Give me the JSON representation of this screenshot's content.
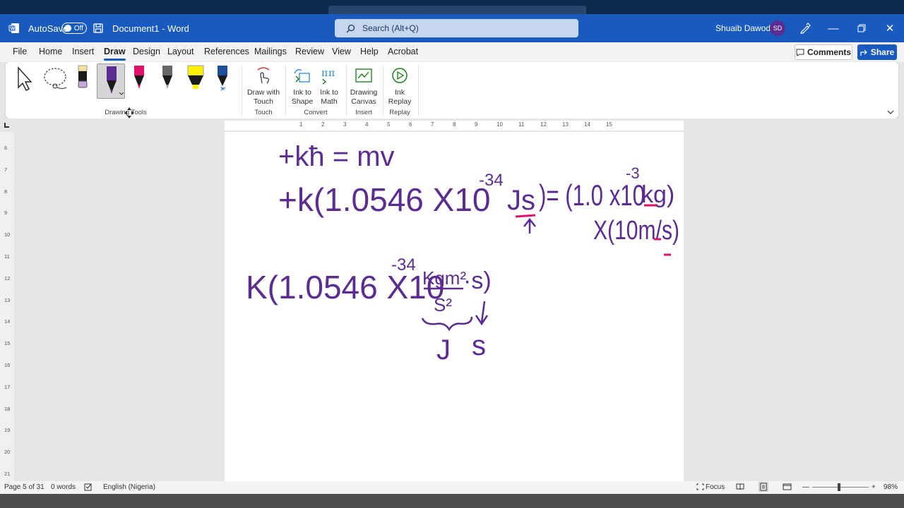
{
  "titlebar": {
    "autosave_label": "AutoSave",
    "autosave_state": "Off",
    "doc_name": "Document1",
    "separator": "-",
    "app_name": "Word",
    "search_placeholder": "Search (Alt+Q)",
    "user_name": "Shuaib Dawodu",
    "user_initials": "SD"
  },
  "menu": [
    "File",
    "Home",
    "Insert",
    "Draw",
    "Design",
    "Layout",
    "References",
    "Mailings",
    "Review",
    "View",
    "Help",
    "Acrobat"
  ],
  "menu_active": "Draw",
  "actions": {
    "comments": "Comments",
    "share": "Share"
  },
  "ribbon": {
    "drawing_tools_label": "Drawing Tools",
    "pens": [
      {
        "name": "black-pencil",
        "color": "#1a1a1a"
      },
      {
        "name": "purple-pen",
        "color": "#5c2d91"
      },
      {
        "name": "pink-pen",
        "color": "#e3106a"
      },
      {
        "name": "gray-pencil",
        "color": "#4a4a4a"
      },
      {
        "name": "yellow-highlighter",
        "color": "#fff200"
      },
      {
        "name": "blue-galaxy-pen",
        "color": "#1f4e99"
      }
    ],
    "draw_with_touch": [
      "Draw with",
      "Touch"
    ],
    "touch_label": "Touch",
    "ink_to_shape": [
      "Ink to",
      "Shape"
    ],
    "ink_to_math": [
      "Ink to",
      "Math"
    ],
    "convert_label": "Convert",
    "drawing_canvas": [
      "Drawing",
      "Canvas"
    ],
    "insert_label": "Insert",
    "ink_replay": [
      "Ink",
      "Replay"
    ],
    "replay_label": "Replay"
  },
  "ruler": {
    "h_ticks": [
      "1",
      "2",
      "3",
      "4",
      "5",
      "6",
      "7",
      "8",
      "9",
      "10",
      "11",
      "12",
      "13",
      "14",
      "15"
    ],
    "v_ticks": [
      "6",
      "7",
      "8",
      "9",
      "10",
      "11",
      "12",
      "13",
      "14",
      "15",
      "16",
      "17",
      "18",
      "19",
      "20",
      "21"
    ]
  },
  "ink": {
    "line1": "+kħ = mv",
    "line2": "+k(1.0546 X10",
    "line2_exp": "-34",
    "line2_unit": "Js",
    "line2_rhs": ")= (1.0 x10",
    "line2_rhs_exp": "-3",
    "line2_rhs_unit": "kg)",
    "line3": "X(10m/s)",
    "line4": "K(1.0546 X10",
    "line4_exp": "-34",
    "line4_frac_num": "Kgm²",
    "line4_frac_den": "S²",
    "line4_dot_s": "·s)",
    "line5_j": "J",
    "line5_s": "s",
    "ink_color": "#5c2d91",
    "accent_color": "#e3106a"
  },
  "status": {
    "page": "Page 5 of 31",
    "words": "0 words",
    "language": "English (Nigeria)",
    "focus": "Focus",
    "zoom": "98%"
  }
}
